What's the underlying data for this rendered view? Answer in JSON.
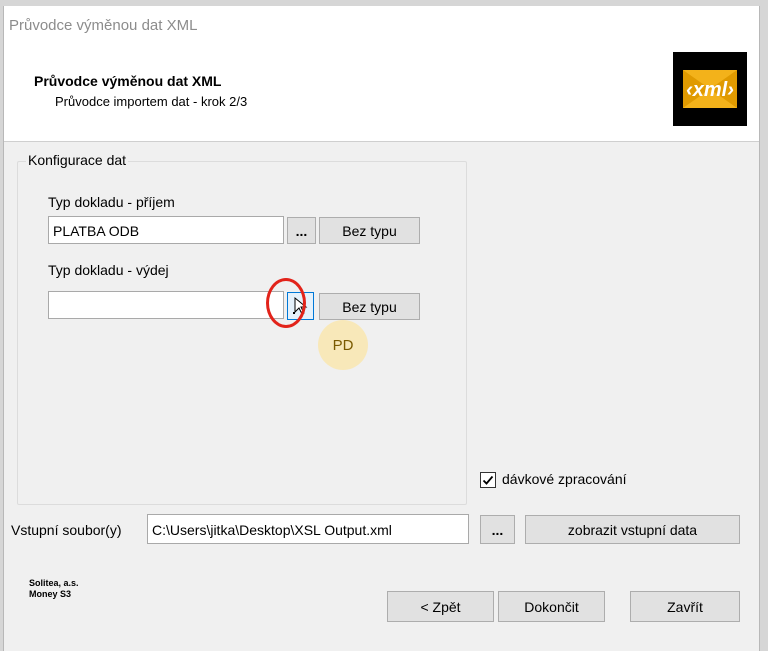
{
  "window": {
    "title": "Průvodce výměnou dat XML"
  },
  "header": {
    "title": "Průvodce výměnou dat XML",
    "subtitle": "Průvodce importem dat - krok 2/3",
    "logo_text": "‹xml›"
  },
  "config": {
    "group_label": "Konfigurace dat",
    "income": {
      "label": "Typ dokladu - příjem",
      "value": "PLATBA ODB",
      "browse_label": "...",
      "no_type_label": "Bez typu"
    },
    "expense": {
      "label": "Typ dokladu - výdej",
      "value": "",
      "no_type_label": "Bez typu"
    }
  },
  "cursor_overlay": {
    "initials": "PD"
  },
  "batch": {
    "label": "dávkové zpracování",
    "checked": true
  },
  "input_file": {
    "label": "Vstupní soubor(y)",
    "value": "C:\\Users\\jitka\\Desktop\\XSL Output.xml",
    "browse_label": "...",
    "show_data_label": "zobrazit vstupní data"
  },
  "company": {
    "line1": "Solitea, a.s.",
    "line2": "Money S3"
  },
  "footer": {
    "back_label": "< Zpět",
    "finish_label": "Dokončit",
    "close_label": "Zavřít"
  }
}
